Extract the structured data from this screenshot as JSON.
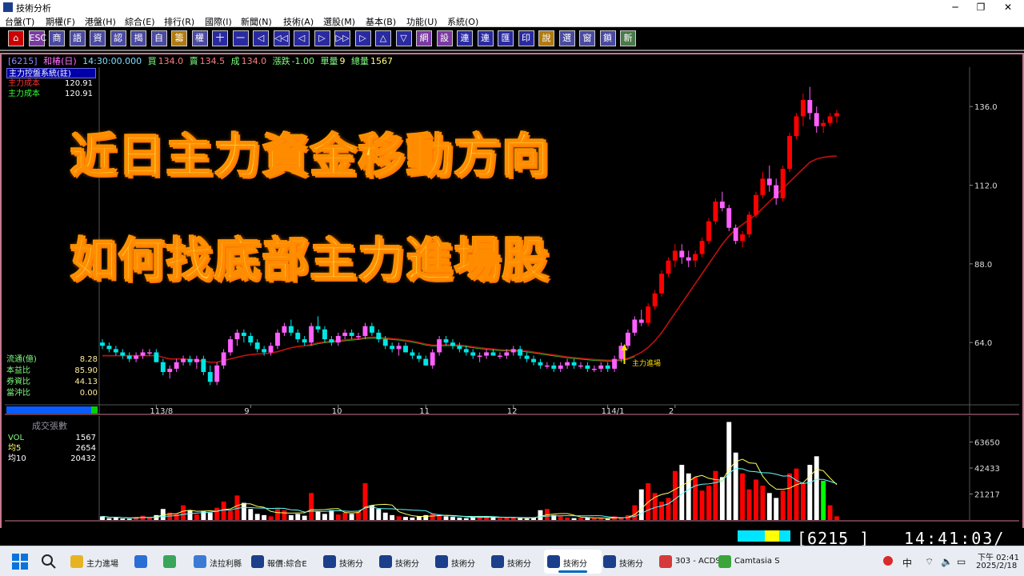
{
  "window": {
    "title": "技術分析",
    "min": "─",
    "max": "❐",
    "close": "✕"
  },
  "menu": [
    "台盤(T)",
    "期權(F)",
    "港盤(H)",
    "綜合(E)",
    "排行(R)",
    "國際(I)",
    "新聞(N)",
    "技術(A)",
    "選股(M)",
    "基本(B)",
    "功能(U)",
    "系統(O)"
  ],
  "toolbar": [
    "⌂",
    "ESC",
    "商",
    "語",
    "資",
    "認",
    "揭",
    "自",
    "籌",
    "權",
    "十",
    "一",
    "◁",
    "◁◁",
    "◁",
    "▷",
    "▷▷",
    "▷",
    "△",
    "▽",
    "網",
    "設",
    "連",
    "連",
    "匯",
    "印",
    "說",
    "選",
    "窗",
    "鎖",
    "新"
  ],
  "quote": {
    "code": "[6215]",
    "name": "和椿(日)",
    "time": "14:30:00.000",
    "buy_label": "買",
    "buy": "134.0",
    "sell_label": "賣",
    "sell": "134.5",
    "deal_label": "成",
    "deal": "134.0",
    "change_label": "漲跌",
    "change": "-1.00",
    "unit_vol_label": "單量",
    "unit_vol": "9",
    "total_vol_label": "總量",
    "total_vol": "1567"
  },
  "legend": {
    "title": "主力控盤系統(註)",
    "rows": [
      {
        "label": "主力成本",
        "value": "120.91",
        "color": "#ff3030"
      },
      {
        "label": "主力成本",
        "value": "120.91",
        "color": "#30ff30"
      }
    ]
  },
  "overlay": {
    "line1": "近日主力資金移動方向",
    "line2": "如何找底部主力進場股"
  },
  "stats": [
    {
      "label": "流通(億)",
      "value": "8.28"
    },
    {
      "label": "本益比",
      "value": "85.90"
    },
    {
      "label": "券資比",
      "value": "44.13"
    },
    {
      "label": "當沖比",
      "value": "0.00"
    }
  ],
  "annotation": "主力進場",
  "volume_panel": {
    "title": "成交張數",
    "rows": [
      {
        "label": "VOL",
        "value": "1567"
      },
      {
        "label": "均5",
        "value": "2654"
      },
      {
        "label": "均10",
        "value": "20432"
      }
    ]
  },
  "bottom": {
    "symbol": "[6215  ]",
    "time": "14:41:03/"
  },
  "taskbar": {
    "items": [
      {
        "label": "主力進場",
        "color": "#e6b422"
      },
      {
        "label": "",
        "color": "#2a6fd6"
      },
      {
        "label": "",
        "color": "#3aa55a"
      },
      {
        "label": "法拉利縣",
        "color": "#3b7bd6"
      },
      {
        "label": "報價:綜合E",
        "color": "#1c3f8c"
      },
      {
        "label": "技術分",
        "color": "#1c3f8c"
      },
      {
        "label": "技術分",
        "color": "#1c3f8c"
      },
      {
        "label": "技術分",
        "color": "#1c3f8c"
      },
      {
        "label": "技術分",
        "color": "#1c3f8c"
      },
      {
        "label": "技術分",
        "color": "#1c3f8c"
      },
      {
        "label": "技術分",
        "color": "#1c3f8c"
      },
      {
        "label": "303 - ACDS",
        "color": "#d63a3a"
      },
      {
        "label": "Camtasia S",
        "color": "#3aa53a"
      }
    ],
    "ime": "中",
    "clock_time": "下午 02:41",
    "clock_date": "2025/2/18"
  },
  "chart_data": [
    {
      "type": "candlestick",
      "title": "",
      "y_ticks": [
        "136.0",
        "112.0",
        "88.0",
        "64.0"
      ],
      "x_ticks": [
        "113/8",
        "9",
        "10",
        "11",
        "12",
        "114/1",
        "2"
      ],
      "colors": {
        "up": "#ff0000",
        "down": "#00e5e5",
        "up_shadow": "#ff60ff",
        "ma_red": "#c01010",
        "ma_green": "#20c020"
      },
      "ohlc": [
        [
          64,
          65,
          62,
          63
        ],
        [
          63,
          64,
          61,
          62
        ],
        [
          62,
          63,
          60,
          61
        ],
        [
          61,
          62,
          59,
          60
        ],
        [
          60,
          61,
          58,
          59
        ],
        [
          59,
          61,
          58,
          60
        ],
        [
          60,
          62,
          59,
          61
        ],
        [
          61,
          62,
          60,
          61
        ],
        [
          61,
          62,
          58,
          58
        ],
        [
          58,
          59,
          54,
          55
        ],
        [
          55,
          57,
          53,
          56
        ],
        [
          56,
          59,
          55,
          58
        ],
        [
          58,
          60,
          57,
          59
        ],
        [
          59,
          60,
          57,
          58
        ],
        [
          58,
          60,
          56,
          59
        ],
        [
          59,
          60,
          54,
          55
        ],
        [
          55,
          57,
          51,
          52
        ],
        [
          52,
          58,
          51,
          57
        ],
        [
          57,
          62,
          56,
          61
        ],
        [
          61,
          66,
          60,
          65
        ],
        [
          65,
          68,
          63,
          67
        ],
        [
          67,
          68,
          64,
          66
        ],
        [
          66,
          67,
          63,
          64
        ],
        [
          64,
          65,
          61,
          62
        ],
        [
          62,
          63,
          60,
          61
        ],
        [
          61,
          64,
          60,
          63
        ],
        [
          63,
          68,
          62,
          67
        ],
        [
          67,
          70,
          66,
          69
        ],
        [
          69,
          71,
          66,
          67
        ],
        [
          67,
          68,
          64,
          65
        ],
        [
          65,
          66,
          63,
          64
        ],
        [
          64,
          70,
          63,
          69
        ],
        [
          69,
          72,
          67,
          68
        ],
        [
          68,
          69,
          64,
          65
        ],
        [
          65,
          66,
          63,
          64
        ],
        [
          64,
          67,
          63,
          66
        ],
        [
          66,
          68,
          65,
          67
        ],
        [
          67,
          68,
          65,
          66
        ],
        [
          66,
          67,
          65,
          66
        ],
        [
          66,
          70,
          65,
          69
        ],
        [
          69,
          70,
          66,
          67
        ],
        [
          67,
          68,
          64,
          65
        ],
        [
          65,
          66,
          62,
          63
        ],
        [
          63,
          64,
          61,
          62
        ],
        [
          62,
          64,
          60,
          63
        ],
        [
          63,
          64,
          61,
          61
        ],
        [
          61,
          62,
          59,
          60
        ],
        [
          60,
          61,
          58,
          59
        ],
        [
          59,
          60,
          57,
          57
        ],
        [
          57,
          62,
          56,
          61
        ],
        [
          61,
          66,
          60,
          65
        ],
        [
          65,
          66,
          63,
          64
        ],
        [
          64,
          65,
          62,
          63
        ],
        [
          63,
          64,
          61,
          62
        ],
        [
          62,
          63,
          60,
          61
        ],
        [
          61,
          62,
          59,
          60
        ],
        [
          60,
          61,
          58,
          60
        ],
        [
          60,
          62,
          59,
          61
        ],
        [
          61,
          62,
          60,
          60
        ],
        [
          60,
          61,
          59,
          60
        ],
        [
          60,
          62,
          59,
          61
        ],
        [
          61,
          63,
          60,
          62
        ],
        [
          62,
          63,
          59,
          60
        ],
        [
          60,
          61,
          58,
          59
        ],
        [
          59,
          60,
          57,
          58
        ],
        [
          58,
          59,
          56,
          57
        ],
        [
          57,
          58,
          56,
          57
        ],
        [
          57,
          58,
          55,
          56
        ],
        [
          56,
          58,
          55,
          57
        ],
        [
          57,
          59,
          56,
          58
        ],
        [
          58,
          59,
          56,
          57
        ],
        [
          57,
          58,
          56,
          57
        ],
        [
          57,
          58,
          55,
          56
        ],
        [
          56,
          57,
          55,
          56
        ],
        [
          56,
          58,
          55,
          57
        ],
        [
          57,
          58,
          55,
          56
        ],
        [
          56,
          60,
          55,
          59
        ],
        [
          59,
          64,
          58,
          63
        ],
        [
          63,
          68,
          62,
          67
        ],
        [
          67,
          72,
          66,
          71
        ],
        [
          71,
          74,
          69,
          70
        ],
        [
          70,
          76,
          69,
          75
        ],
        [
          75,
          80,
          74,
          79
        ],
        [
          79,
          86,
          78,
          85
        ],
        [
          85,
          90,
          84,
          89
        ],
        [
          89,
          94,
          87,
          92
        ],
        [
          92,
          94,
          88,
          90
        ],
        [
          90,
          92,
          87,
          89
        ],
        [
          89,
          92,
          87,
          91
        ],
        [
          91,
          96,
          90,
          95
        ],
        [
          95,
          102,
          94,
          101
        ],
        [
          101,
          108,
          100,
          107
        ],
        [
          107,
          110,
          104,
          105
        ],
        [
          105,
          106,
          98,
          99
        ],
        [
          99,
          100,
          94,
          95
        ],
        [
          95,
          98,
          93,
          97
        ],
        [
          97,
          104,
          96,
          103
        ],
        [
          103,
          110,
          102,
          109
        ],
        [
          109,
          116,
          108,
          114
        ],
        [
          114,
          118,
          110,
          112
        ],
        [
          112,
          114,
          106,
          108
        ],
        [
          108,
          118,
          107,
          117
        ],
        [
          117,
          128,
          116,
          127
        ],
        [
          127,
          134,
          126,
          133
        ],
        [
          133,
          140,
          130,
          138
        ],
        [
          138,
          142,
          132,
          134
        ],
        [
          134,
          136,
          128,
          130
        ],
        [
          130,
          132,
          128,
          131
        ],
        [
          131,
          134,
          130,
          133
        ],
        [
          133,
          135,
          131,
          134
        ]
      ],
      "ma": [
        [
          60
        ],
        [
          60
        ],
        [
          60
        ],
        [
          60
        ],
        [
          60
        ],
        [
          60
        ],
        [
          60
        ],
        [
          60
        ],
        [
          60
        ],
        [
          59.5
        ],
        [
          59
        ],
        [
          59
        ],
        [
          59
        ],
        [
          58.8
        ],
        [
          58.6
        ],
        [
          58.3
        ],
        [
          58
        ],
        [
          58
        ],
        [
          58.5
        ],
        [
          59
        ],
        [
          59.5
        ],
        [
          60
        ],
        [
          60.3
        ],
        [
          60.5
        ],
        [
          60.6
        ],
        [
          60.8
        ],
        [
          61.2
        ],
        [
          61.8
        ],
        [
          62.4
        ],
        [
          62.8
        ],
        [
          63
        ],
        [
          63.4
        ],
        [
          63.9
        ],
        [
          64.2
        ],
        [
          64.4
        ],
        [
          64.6
        ],
        [
          64.8
        ],
        [
          65
        ],
        [
          65.2
        ],
        [
          65.5
        ],
        [
          65.6
        ],
        [
          65.6
        ],
        [
          65.4
        ],
        [
          65.2
        ],
        [
          65
        ],
        [
          64.7
        ],
        [
          64.4
        ],
        [
          64
        ],
        [
          63.5
        ],
        [
          63.2
        ],
        [
          63.2
        ],
        [
          63.3
        ],
        [
          63.3
        ],
        [
          63.2
        ],
        [
          63
        ],
        [
          62.7
        ],
        [
          62.4
        ],
        [
          62.2
        ],
        [
          62
        ],
        [
          61.8
        ],
        [
          61.7
        ],
        [
          61.7
        ],
        [
          61.6
        ],
        [
          61.4
        ],
        [
          61.1
        ],
        [
          60.8
        ],
        [
          60.5
        ],
        [
          60.2
        ],
        [
          59.9
        ],
        [
          59.6
        ],
        [
          59.4
        ],
        [
          59.2
        ],
        [
          59
        ],
        [
          58.8
        ],
        [
          58.7
        ],
        [
          58.6
        ],
        [
          58.6
        ],
        [
          58.8
        ],
        [
          59.2
        ],
        [
          60
        ],
        [
          61
        ],
        [
          62.5
        ],
        [
          64.5
        ],
        [
          67
        ],
        [
          70
        ],
        [
          73
        ],
        [
          76
        ],
        [
          79
        ],
        [
          82
        ],
        [
          85
        ],
        [
          88
        ],
        [
          91
        ],
        [
          94
        ],
        [
          96.5
        ],
        [
          98.5
        ],
        [
          100
        ],
        [
          101.5
        ],
        [
          103
        ],
        [
          105
        ],
        [
          107
        ],
        [
          109
        ],
        [
          111
        ],
        [
          113
        ],
        [
          115
        ],
        [
          117
        ],
        [
          119
        ],
        [
          120
        ],
        [
          120.5
        ],
        [
          120.8
        ],
        [
          120.91
        ]
      ]
    },
    {
      "type": "bar",
      "title": "成交張數",
      "y_ticks": [
        "63650",
        "42433",
        "21217"
      ],
      "values": [
        3000,
        1500,
        2000,
        1200,
        1000,
        2500,
        3500,
        1800,
        4000,
        9000,
        6000,
        5000,
        12000,
        8000,
        4500,
        7000,
        6000,
        10000,
        15000,
        7500,
        20000,
        14000,
        9000,
        5000,
        4000,
        3000,
        9000,
        8000,
        4000,
        5000,
        3500,
        22000,
        7000,
        5000,
        8000,
        4500,
        6000,
        5000,
        7000,
        30000,
        12000,
        9000,
        6000,
        4000,
        3000,
        2500,
        2000,
        3000,
        4000,
        5000,
        4000,
        3000,
        2500,
        2000,
        1500,
        2000,
        2500,
        3000,
        2000,
        1500,
        1800,
        2200,
        1500,
        1200,
        2000,
        8000,
        9000,
        4000,
        3000,
        2000,
        1500,
        1800,
        2000,
        1500,
        1200,
        1000,
        3000,
        2000,
        4000,
        12000,
        25000,
        30000,
        22000,
        15000,
        18000,
        40000,
        45000,
        38000,
        35000,
        24000,
        28000,
        40000,
        35000,
        80000,
        55000,
        38000,
        25000,
        33000,
        28000,
        22000,
        18000,
        24000,
        38000,
        42000,
        30000,
        45000,
        52000,
        32000,
        12000,
        3000
      ],
      "colors": {
        "up": "#ff0000",
        "down": "#ffffff",
        "last": "#00ff00"
      }
    }
  ]
}
